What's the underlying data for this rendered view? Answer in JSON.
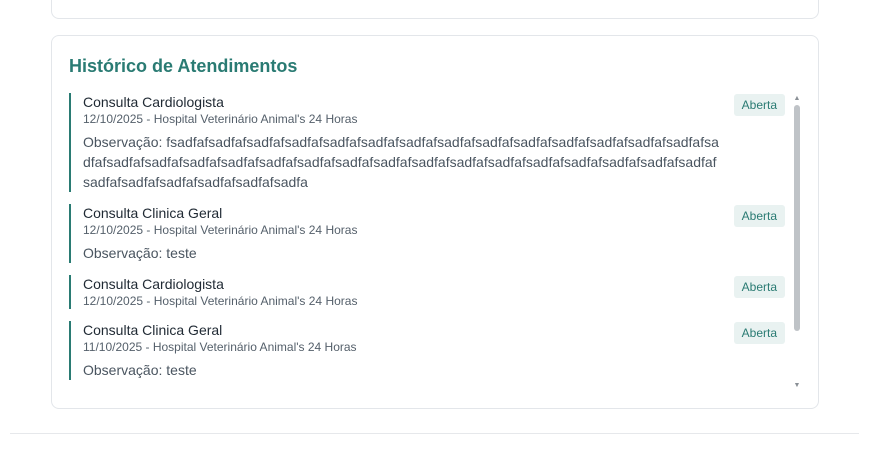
{
  "history": {
    "title": "Histórico de Atendimentos",
    "items": [
      {
        "title": "Consulta Cardiologista",
        "subtitle": "12/10/2025 - Hospital Veterinário Animal's 24 Horas",
        "observation": "Observação: fsadfafsadfafsadfafsadfafsadfafsadfafsadfafsadfafsadfafsadfafsadfafsadfafsadfafsadfafsadfafsadfafsadfafsadfafsadfafsadfafsadfafsadfafsadfafsadfafsadfafsadfafsadfafsadfafsadfafsadfafsadfafsadfafsadfafsadfafsadfafsadfafsadfa",
        "status": "Aberta"
      },
      {
        "title": "Consulta Clinica Geral",
        "subtitle": "12/10/2025 - Hospital Veterinário Animal's 24 Horas",
        "observation": "Observação: teste",
        "status": "Aberta"
      },
      {
        "title": "Consulta Cardiologista",
        "subtitle": "12/10/2025 - Hospital Veterinário Animal's 24 Horas",
        "observation": "",
        "status": "Aberta"
      },
      {
        "title": "Consulta Clinica Geral",
        "subtitle": "11/10/2025 - Hospital Veterinário Animal's 24 Horas",
        "observation": "Observação: teste",
        "status": "Aberta"
      }
    ]
  },
  "icons": {
    "scroll_up": "caret-up-icon",
    "scroll_down": "caret-down-icon"
  },
  "colors": {
    "accent": "#2a7b73",
    "badge_bg": "#e9f2f1",
    "border": "#e3e6ea"
  }
}
